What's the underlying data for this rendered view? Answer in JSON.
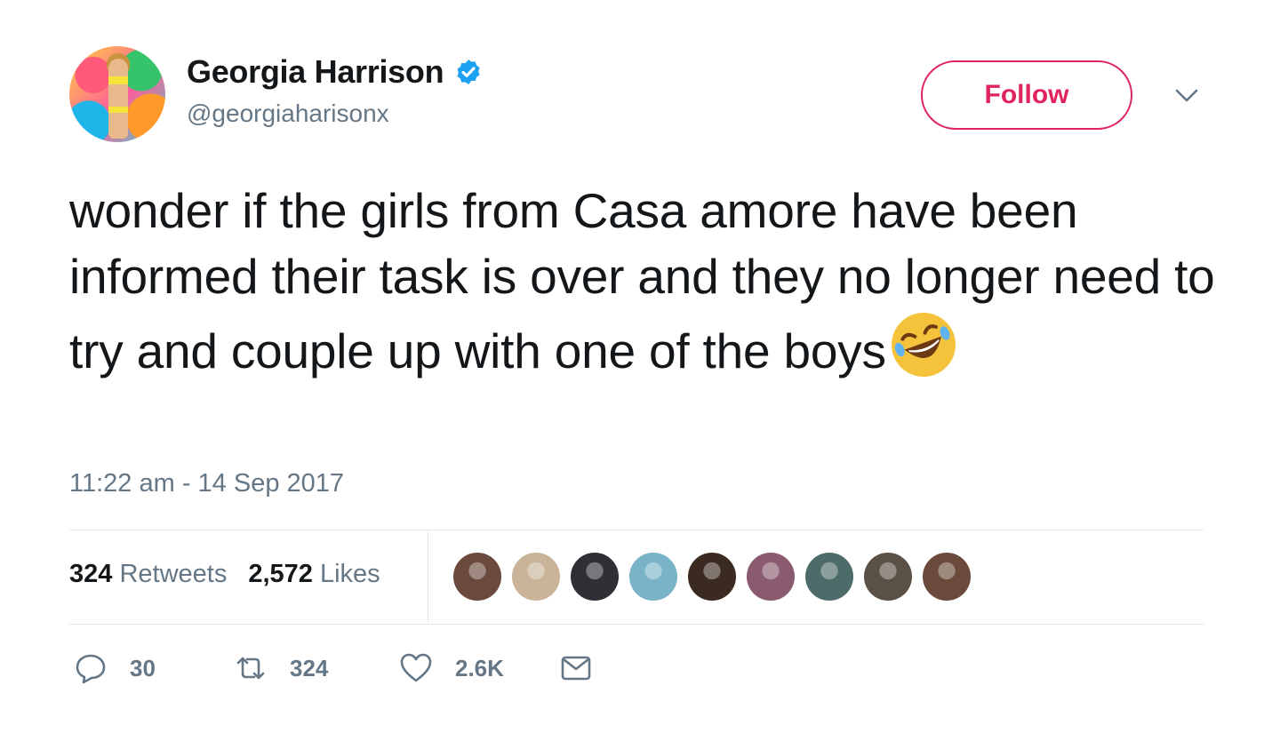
{
  "author": {
    "display_name": "Georgia Harrison",
    "handle": "@georgiaharisonx",
    "verified": true
  },
  "follow_label": "Follow",
  "tweet": {
    "text": "wonder if the girls from Casa amore have been informed their task is over and they no longer need to try and couple up with one of the boys",
    "emoji": "rolling-on-the-floor-laughing",
    "timestamp": "11:22 am - 14 Sep 2017"
  },
  "stats": {
    "retweets_count": "324",
    "retweets_label": "Retweets",
    "likes_count": "2,572",
    "likes_label": "Likes"
  },
  "likers": [
    {
      "color": "#6b4a3e"
    },
    {
      "color": "#c9b49a"
    },
    {
      "color": "#2f2f35"
    },
    {
      "color": "#7ab3c7"
    },
    {
      "color": "#3a2a20"
    },
    {
      "color": "#8a5a6e"
    },
    {
      "color": "#4d6b68"
    },
    {
      "color": "#5a5046"
    },
    {
      "color": "#6a4a3a"
    }
  ],
  "actions": {
    "reply_count": "30",
    "retweet_count": "324",
    "like_count": "2.6K"
  },
  "colors": {
    "follow_accent": "#e0245e",
    "verified_blue": "#1da1f2",
    "secondary_text": "#657786"
  }
}
